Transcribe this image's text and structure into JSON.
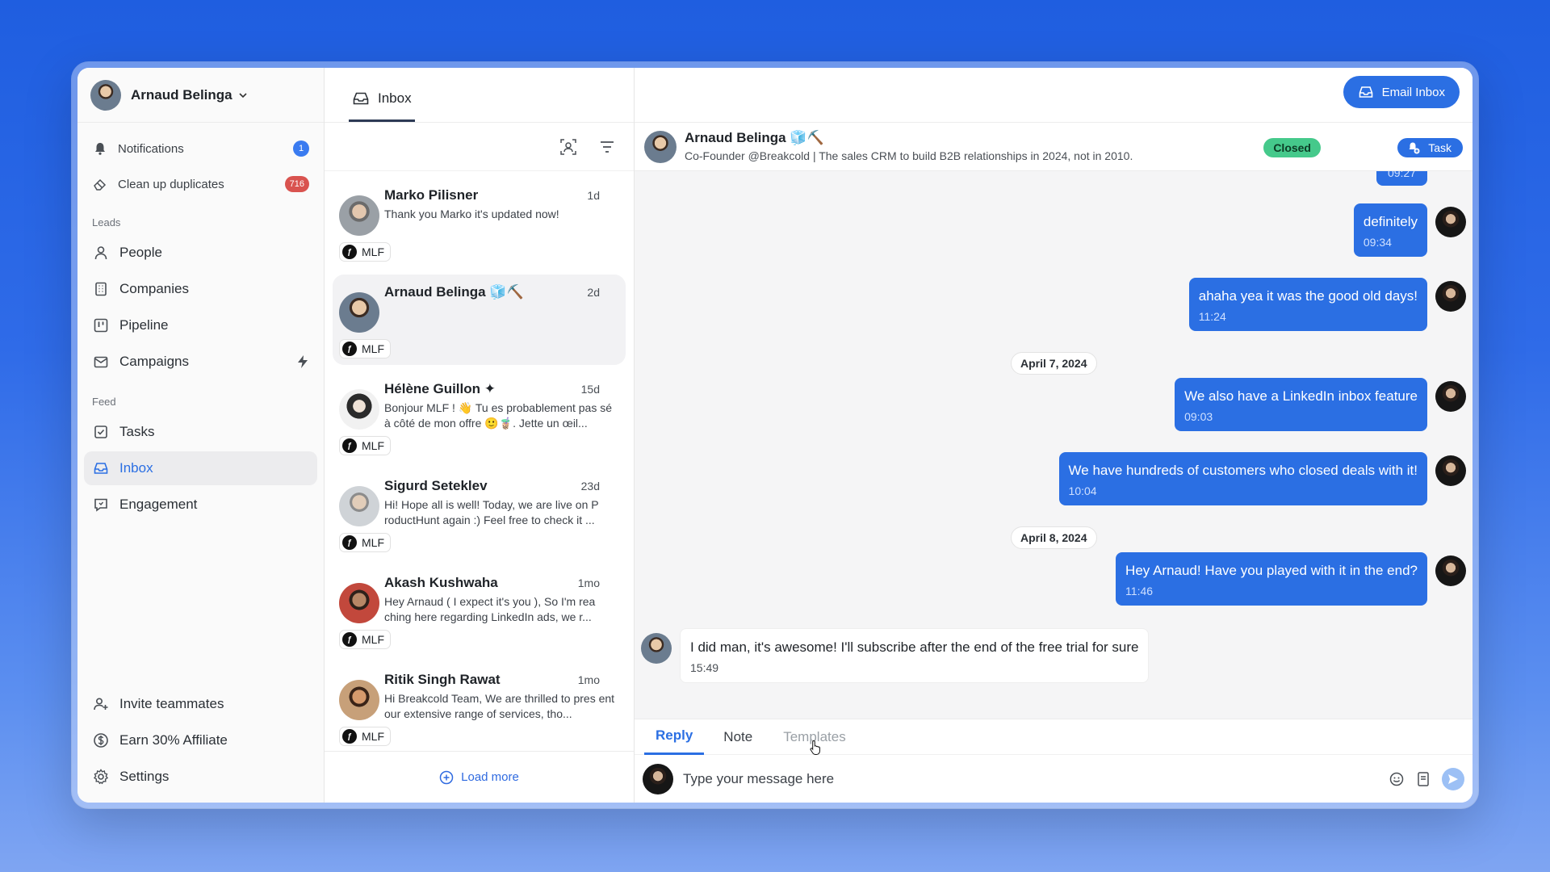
{
  "user": {
    "name": "Arnaud Belinga"
  },
  "sidebar": {
    "top_items": [
      {
        "label": "Notifications",
        "badge": "1",
        "icon": "bell-icon"
      },
      {
        "label": "Clean up duplicates",
        "badge": "716",
        "icon": "eraser-icon"
      }
    ],
    "leads_section": "Leads",
    "leads": [
      {
        "label": "People",
        "icon": "person-icon"
      },
      {
        "label": "Companies",
        "icon": "building-icon"
      },
      {
        "label": "Pipeline",
        "icon": "kanban-icon"
      },
      {
        "label": "Campaigns",
        "icon": "mail-stack-icon"
      }
    ],
    "feed_section": "Feed",
    "feed": [
      {
        "label": "Tasks",
        "icon": "checkbox-icon"
      },
      {
        "label": "Inbox",
        "icon": "inbox-icon"
      },
      {
        "label": "Engagement",
        "icon": "chat-icon"
      }
    ],
    "bottom": [
      {
        "label": "Invite teammates",
        "icon": "user-plus-icon"
      },
      {
        "label": "Earn 30% Affiliate",
        "icon": "dollar-icon"
      },
      {
        "label": "Settings",
        "icon": "gear-icon"
      }
    ]
  },
  "inbox": {
    "tab_label": "Inbox",
    "conversations": [
      {
        "name": "Marko Pilisner",
        "time": "1d",
        "snippet": "Thank you Marko it's updated now!",
        "tag": "MLF"
      },
      {
        "name": "Arnaud Belinga 🧊⛏️",
        "time": "2d",
        "snippet": "",
        "tag": "MLF"
      },
      {
        "name": "Hélène Guillon ✦",
        "time": "15d",
        "snippet": "Bonjour MLF ! 👋 Tu es probablement pas sé à côté de mon offre 🙂🧋. Jette un œil...",
        "tag": "MLF"
      },
      {
        "name": "Sigurd Seteklev",
        "time": "23d",
        "snippet": "Hi! Hope all is well! Today, we are live on P roductHunt again :) Feel free to check it ...",
        "tag": "MLF"
      },
      {
        "name": "Akash Kushwaha",
        "time": "1mo",
        "snippet": "Hey Arnaud ( I expect it's you ), So I'm rea ching here regarding LinkedIn ads, we r...",
        "tag": "MLF"
      },
      {
        "name": "Ritik Singh Rawat",
        "time": "1mo",
        "snippet": "Hi Breakcold Team, We are thrilled to pres ent our extensive range of services, tho...",
        "tag": "MLF"
      }
    ],
    "load_more": "Load more"
  },
  "header": {
    "email_inbox_label": "Email Inbox"
  },
  "contact": {
    "name": "Arnaud Belinga 🧊⛏️",
    "bio": "Co-Founder @Breakcold | The sales CRM to build B2B relationships in 2024, not in 2010.",
    "status": "Closed",
    "task_label": "Task"
  },
  "messages": {
    "partial_time": "09:27",
    "outgoing": [
      {
        "text": "definitely",
        "time": "09:34"
      },
      {
        "text": "ahaha yea it was the good old days!",
        "time": "11:24"
      },
      {
        "text": "We also have a LinkedIn inbox feature",
        "time": "09:03"
      },
      {
        "text": "We have hundreds of customers who closed deals with it!",
        "time": "10:04"
      },
      {
        "text": "Hey Arnaud! Have you played with it in the end?",
        "time": "11:46"
      }
    ],
    "dates": [
      "April 7, 2024",
      "April 8, 2024"
    ],
    "incoming": {
      "text": "I did man, it's awesome! I'll subscribe after the end of the free trial for sure",
      "time": "15:49"
    }
  },
  "composer": {
    "tabs": [
      "Reply",
      "Note",
      "Templates"
    ],
    "placeholder": "Type your message here"
  },
  "colors": {
    "accent": "#2b6fe3",
    "closed": "#45c98b",
    "badge_red": "#d9534f"
  }
}
